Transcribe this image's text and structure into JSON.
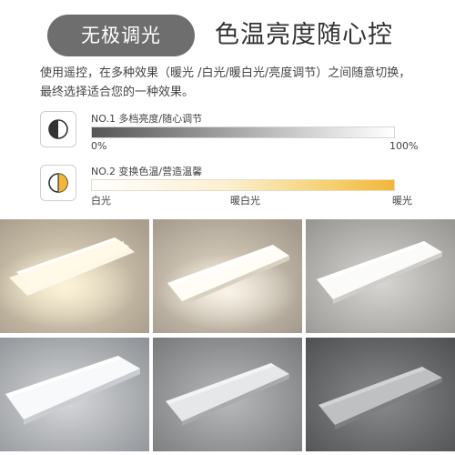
{
  "header": {
    "badge": "无极调光",
    "headline": "色温亮度随心控"
  },
  "description": "使用遥控，在多种效果（暖光 /白光/暖白光/亮度调节）之间随意切换，最终选择适合您的一种效果。",
  "features": {
    "brightness": {
      "label": "NO.1  多档亮度/随心调节",
      "min_label": "0%",
      "max_label": "100%",
      "icon": "half-moon-contrast-icon"
    },
    "color_temp": {
      "label": "NO.2  变换色温/营造温馨",
      "start_label": "白光",
      "mid_label": "暖白光",
      "end_label": "暖光",
      "icon": "half-warm-light-icon"
    }
  },
  "colors": {
    "badge": "#6e6e6e",
    "warm": "#f2b63b",
    "dark": "#555555"
  }
}
